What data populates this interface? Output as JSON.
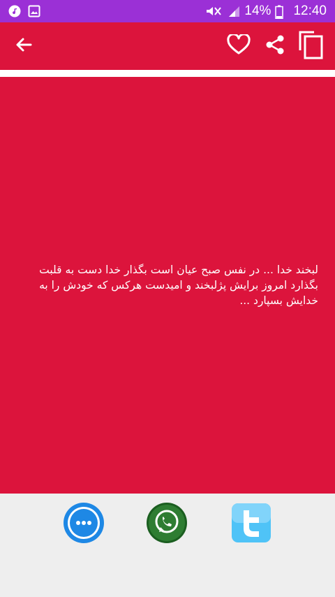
{
  "status_bar": {
    "battery_percent": "14%",
    "time": "12:40",
    "icons": [
      "music-icon",
      "image-icon",
      "mute-icon",
      "signal-icon",
      "battery-icon"
    ]
  },
  "toolbar": {
    "icons": [
      "back-arrow-icon",
      "heart-icon",
      "share-icon",
      "copy-icon"
    ]
  },
  "quote": {
    "text": "لبخند خدا ... در نفس صبح عیان است بگذار خدا دست به قلبت بگذارد امروز برایش پژلبخند و امیدست هرکس که خودش را به خدایش بسپارد ..."
  },
  "share_bar": {
    "buttons": [
      "messages-icon",
      "whatsapp-icon",
      "twitter-icon"
    ]
  },
  "colors": {
    "status_bar": "#9b30d6",
    "accent_red": "#dc143c",
    "bottom_bar": "#eeeeee"
  }
}
